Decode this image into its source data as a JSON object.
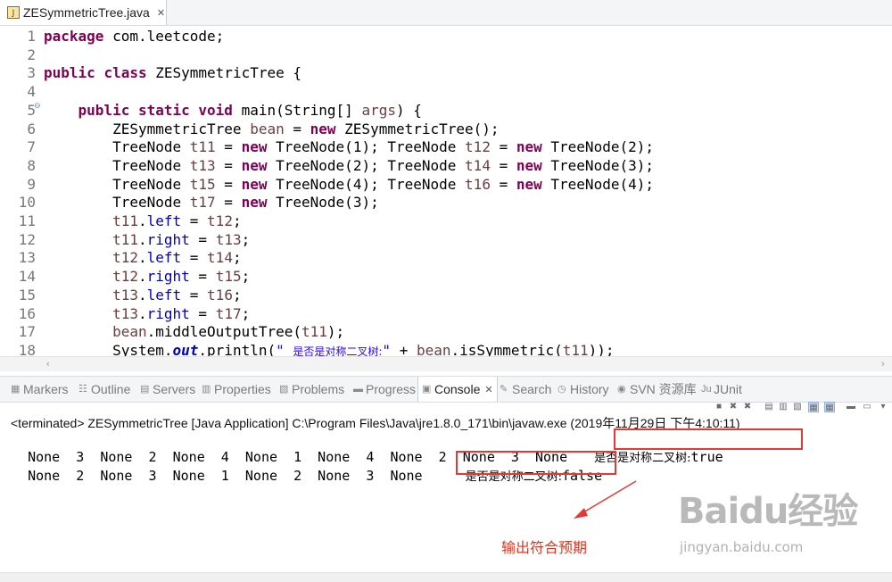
{
  "editor_tab": {
    "icon": "J",
    "title": "ZESymmetricTree.java",
    "close": "✕"
  },
  "code_lines": [
    {
      "n": "1",
      "h": "<span class=\"kw\">package</span> com.leetcode;"
    },
    {
      "n": "2",
      "h": ""
    },
    {
      "n": "3",
      "h": "<span class=\"kw\">public</span> <span class=\"kw\">class</span> ZESymmetricTree {"
    },
    {
      "n": "4",
      "h": ""
    },
    {
      "n": "5",
      "h": "    <span class=\"kw\">public</span> <span class=\"kw\">static</span> <span class=\"kw\">void</span> main(String[] <span class=\"var\">args</span>) {"
    },
    {
      "n": "6",
      "h": "        ZESymmetricTree <span class=\"var\">bean</span> = <span class=\"kw\">new</span> ZESymmetricTree();"
    },
    {
      "n": "7",
      "h": "        TreeNode <span class=\"var\">t11</span> = <span class=\"kw\">new</span> TreeNode(1); TreeNode <span class=\"var\">t12</span> = <span class=\"kw\">new</span> TreeNode(2);"
    },
    {
      "n": "8",
      "h": "        TreeNode <span class=\"var\">t13</span> = <span class=\"kw\">new</span> TreeNode(2); TreeNode <span class=\"var\">t14</span> = <span class=\"kw\">new</span> TreeNode(3);"
    },
    {
      "n": "9",
      "h": "        TreeNode <span class=\"var\">t15</span> = <span class=\"kw\">new</span> TreeNode(4); TreeNode <span class=\"var\">t16</span> = <span class=\"kw\">new</span> TreeNode(4);"
    },
    {
      "n": "10",
      "h": "        TreeNode <span class=\"var\">t17</span> = <span class=\"kw\">new</span> TreeNode(3);"
    },
    {
      "n": "11",
      "h": "        <span class=\"var\">t11</span>.<span class=\"fld\">left</span> = <span class=\"var\">t12</span>;"
    },
    {
      "n": "12",
      "h": "        <span class=\"var\">t11</span>.<span class=\"fld\">right</span> = <span class=\"var\">t13</span>;"
    },
    {
      "n": "13",
      "h": "        <span class=\"var\">t12</span>.<span class=\"fld\">left</span> = <span class=\"var\">t14</span>;"
    },
    {
      "n": "14",
      "h": "        <span class=\"var\">t12</span>.<span class=\"fld\">right</span> = <span class=\"var\">t15</span>;"
    },
    {
      "n": "15",
      "h": "        <span class=\"var\">t13</span>.<span class=\"fld\">left</span> = <span class=\"var\">t16</span>;"
    },
    {
      "n": "16",
      "h": "        <span class=\"var\">t13</span>.<span class=\"fld\">right</span> = <span class=\"var\">t17</span>;"
    },
    {
      "n": "17",
      "h": "        <span class=\"var\">bean</span>.middleOutputTree(<span class=\"var\">t11</span>);"
    },
    {
      "n": "18",
      "h": "        System.<span class=\"sfld\">out</span>.println(<span class=\"str\">\" <span class=\"cn\">是否是对称二叉树:</span>\"</span> + <span class=\"var\">bean</span>.isSymmetric(<span class=\"var\">t11</span>));"
    }
  ],
  "view_tabs": [
    {
      "icon": "▦",
      "label": "Markers"
    },
    {
      "icon": "☷",
      "label": "Outline"
    },
    {
      "icon": "▤",
      "label": "Servers"
    },
    {
      "icon": "▥",
      "label": "Properties"
    },
    {
      "icon": "▧",
      "label": "Problems"
    },
    {
      "icon": "▬",
      "label": "Progress"
    },
    {
      "icon": "▣",
      "label": "Console",
      "active": true
    },
    {
      "icon": "✎",
      "label": "Search"
    },
    {
      "icon": "◷",
      "label": "History"
    },
    {
      "icon": "◉",
      "label": "SVN 资源库"
    },
    {
      "icon": "Ju",
      "label": "JUnit"
    }
  ],
  "console": {
    "header": "<terminated> ZESymmetricTree [Java Application] C:\\Program Files\\Java\\jre1.8.0_171\\bin\\javaw.exe (2019年11月29日 下午4:10:11)",
    "line1_values": "None  3  None  2  None  4  None  1  None  4  None  2  None  3  None",
    "line1_label": "是否是对称二叉树:",
    "line1_result": "true",
    "line2_values": "None  2  None  3  None  1  None  2  None  3  None",
    "line2_label": "是否是对称二叉树:",
    "line2_result": "false"
  },
  "annotation": {
    "note": "输出符合预期",
    "color": "#e5331f"
  },
  "watermark": {
    "logo": "Baidu经验",
    "url": "jingyan.baidu.com"
  }
}
